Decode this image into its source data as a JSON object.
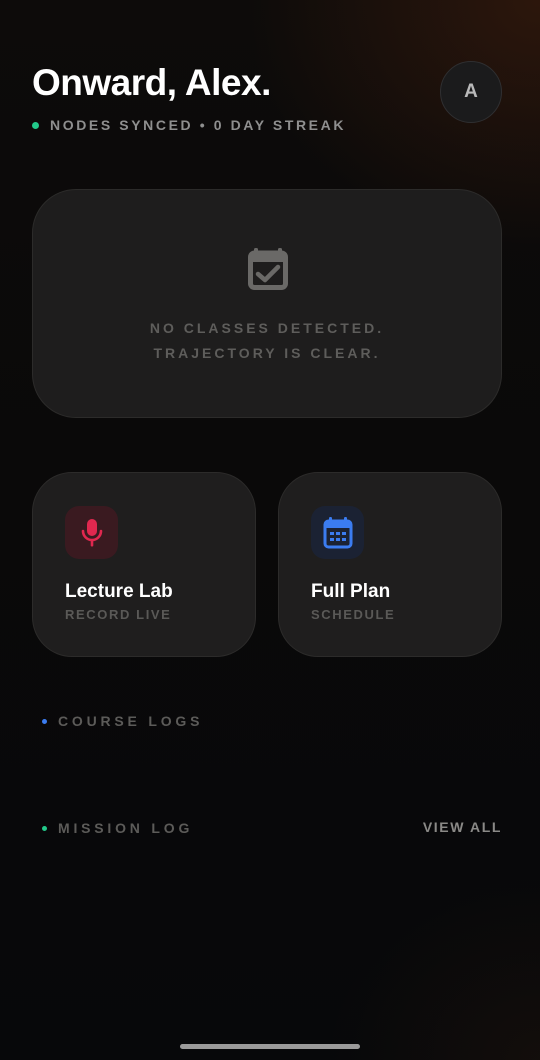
{
  "header": {
    "greeting": "Onward, Alex.",
    "status_text": "NODES SYNCED • 0 DAY STREAK",
    "status_color": "#22c98a",
    "avatar_initial": "A"
  },
  "schedule": {
    "icon": "calendar-check-icon",
    "empty_line_1": "NO CLASSES DETECTED.",
    "empty_line_2": "TRAJECTORY IS CLEAR."
  },
  "tiles": [
    {
      "title": "Lecture Lab",
      "subtitle": "RECORD LIVE",
      "icon": "microphone-icon",
      "accent": "#e0284f",
      "icon_bg": "#3a1a20"
    },
    {
      "title": "Full Plan",
      "subtitle": "SCHEDULE",
      "icon": "calendar-icon",
      "accent": "#3b7cf0",
      "icon_bg": "#1b2233"
    }
  ],
  "sections": {
    "courses_label": "COURSE LOGS",
    "courses_dot_color": "#3b7cf0",
    "missions_label": "MISSION LOG",
    "missions_dot_color": "#22c98a",
    "view_all": "VIEW ALL"
  }
}
